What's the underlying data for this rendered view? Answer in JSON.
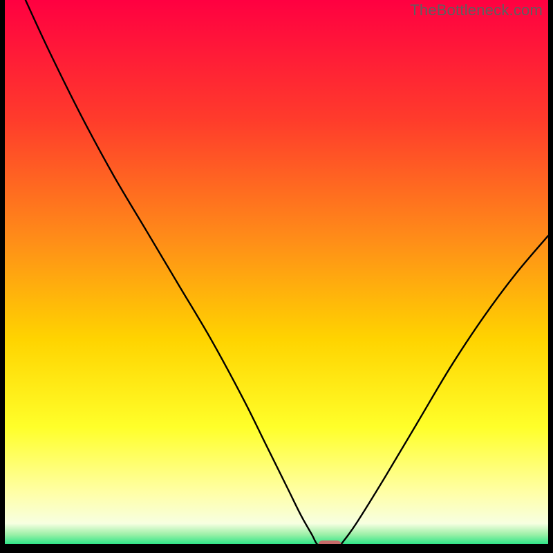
{
  "watermark": "TheBottleneck.com",
  "chart_data": {
    "type": "line",
    "title": "",
    "xlabel": "",
    "ylabel": "",
    "xlim": [
      0,
      100
    ],
    "ylim": [
      0,
      100
    ],
    "grid": false,
    "legend": false,
    "gradient_stops": [
      {
        "pos": 0.0,
        "color": "#ff0041"
      },
      {
        "pos": 0.22,
        "color": "#ff3c2b"
      },
      {
        "pos": 0.44,
        "color": "#ff8e18"
      },
      {
        "pos": 0.62,
        "color": "#ffd400"
      },
      {
        "pos": 0.78,
        "color": "#ffff2a"
      },
      {
        "pos": 0.9,
        "color": "#ffffa8"
      },
      {
        "pos": 0.955,
        "color": "#f7ffe1"
      },
      {
        "pos": 0.975,
        "color": "#9cf0a8"
      },
      {
        "pos": 1.0,
        "color": "#00e27a"
      }
    ],
    "series": [
      {
        "name": "bottleneck-curve",
        "x": [
          3.8,
          8,
          14,
          20,
          26,
          32,
          38,
          44,
          48,
          52,
          54.5,
          56.5,
          57.5,
          58.5,
          61.5,
          62.5,
          65,
          70,
          76,
          82,
          88,
          94,
          100
        ],
        "y": [
          100,
          91,
          79,
          68,
          58,
          48,
          38,
          27,
          19,
          11,
          6,
          2.5,
          0.7,
          0.7,
          0.7,
          1.5,
          5,
          13,
          23,
          33,
          42,
          50,
          57
        ]
      }
    ],
    "marker": {
      "name": "optimal-marker",
      "x": 59.8,
      "y": 0.6,
      "w": 4.2,
      "h": 1.6,
      "color": "#c86a6a"
    }
  }
}
